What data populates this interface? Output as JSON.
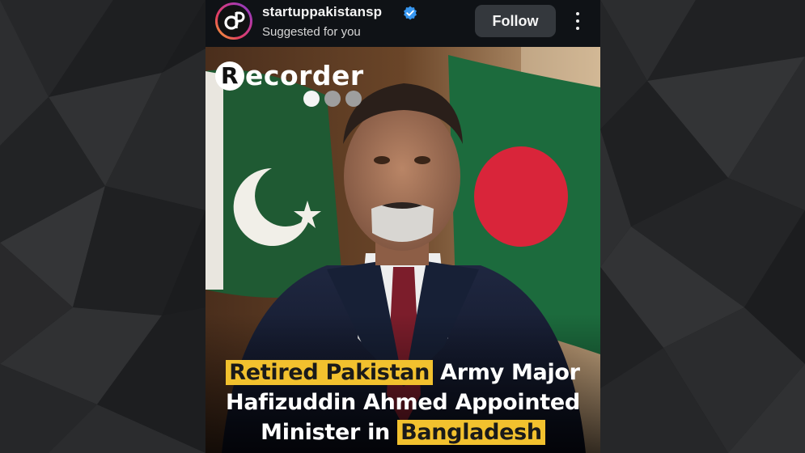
{
  "header": {
    "username": "startuppakistansp",
    "subtitle": "Suggested for you",
    "follow_label": "Follow",
    "avatar_text": "dP"
  },
  "post": {
    "logo_text": "ecorder",
    "logo_initial": "R",
    "carousel_dots": [
      {
        "active": true
      },
      {
        "active": false
      },
      {
        "active": false
      }
    ],
    "headline": {
      "line1_highlight": "Retired Pakistan",
      "line1_rest": " Army Major",
      "line2": "Hafizuddin Ahmed Appointed",
      "line3_pre": "Minister in ",
      "line3_highlight": "Bangladesh"
    }
  },
  "colors": {
    "highlight": "#f2c12e",
    "verified": "#3897f0",
    "follow_bg": "#34383d"
  }
}
